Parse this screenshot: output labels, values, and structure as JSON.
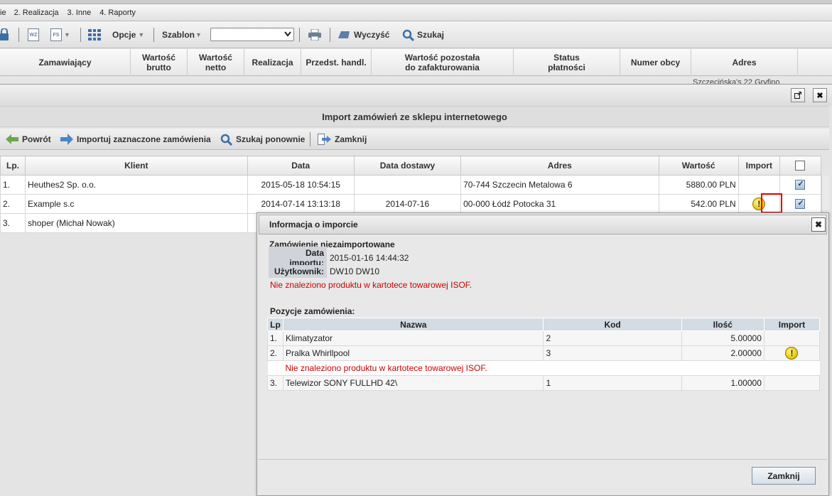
{
  "menu": [
    "ie",
    "2. Realizacja",
    "3. Inne",
    "4. Raporty"
  ],
  "toolbar": {
    "wz": "WZ",
    "fs": "FS",
    "opcje": "Opcje",
    "szablon": "Szablon",
    "wyczysc": "Wyczyść",
    "szukaj": "Szukaj"
  },
  "bg_columns": [
    "Zamawiający",
    "Wartość\nbrutto",
    "Wartość\nnetto",
    "Realizacja",
    "Przedst. handl.",
    "Wartość pozostała\ndo zafakturowania",
    "Status\npłatności",
    "Numer obcy",
    "Adres"
  ],
  "bg_peek": "Szczecińska's 22 Gryfino",
  "panel": {
    "title": "Import zamówień ze sklepu internetowego",
    "actions": {
      "back": "Powrót",
      "import": "Importuj zaznaczone zamówienia",
      "search_again": "Szukaj ponownie",
      "close": "Zamknij"
    },
    "columns": {
      "lp": "Lp.",
      "client": "Klient",
      "date": "Data",
      "delivery": "Data dostawy",
      "address": "Adres",
      "value": "Wartość",
      "import": "Import"
    },
    "rows": [
      {
        "lp": "1.",
        "client": "Heuthes2 Sp. o.o.",
        "date": "2015-05-18 10:54:15",
        "delivery": "",
        "address": "70-744 Szczecin Metalowa 6",
        "value": "5880.00 PLN"
      },
      {
        "lp": "2.",
        "client": "Example s.c",
        "date": "2014-07-14 13:13:18",
        "delivery": "2014-07-16",
        "address": "00-000 Łódź Potocka 31",
        "value": "542.00 PLN"
      },
      {
        "lp": "3.",
        "client": "shoper (Michał Nowak)",
        "date": "",
        "delivery": "",
        "address": "",
        "value": ""
      }
    ]
  },
  "dialog": {
    "title": "Informacja o imporcie",
    "status": "Zamówienie niezaimportowane",
    "import_date_label": "Data importu:",
    "import_date": "2015-01-16 14:44:32",
    "user_label": "Użytkownik:",
    "user": "DW10 DW10",
    "error": "Nie znaleziono produktu w kartotece towarowej ISOF.",
    "positions_label": "Pozycje zamówienia:",
    "pos_columns": {
      "lp": "Lp",
      "name": "Nazwa",
      "code": "Kod",
      "qty": "Ilość",
      "import": "Import"
    },
    "positions": [
      {
        "lp": "1.",
        "name": "Klimatyzator",
        "code": "2",
        "qty": "5.00000"
      },
      {
        "lp": "2.",
        "name": "Pralka Whirllpool",
        "code": "3",
        "qty": "2.00000",
        "error": "Nie znaleziono produktu w kartotece towarowej ISOF."
      },
      {
        "lp": "3.",
        "name": "Telewizor SONY FULLHD 42\\",
        "code": "1",
        "qty": "1.00000"
      }
    ],
    "ok": "Zamknij"
  },
  "colors": {
    "accent_blue": "#3c6fa6",
    "error_red": "#cc0000",
    "warn_yellow": "#e8c400"
  }
}
